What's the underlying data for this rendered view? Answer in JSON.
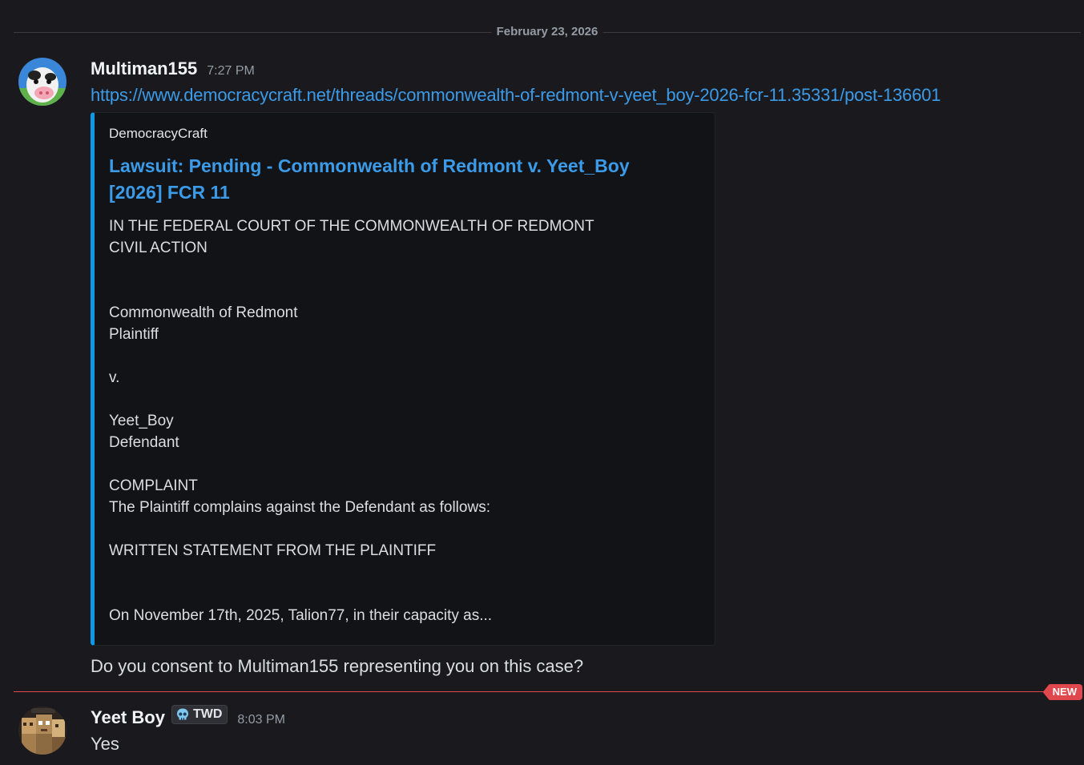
{
  "date_divider": "February 23, 2026",
  "messages": [
    {
      "username": "Multiman155",
      "timestamp": "7:27 PM",
      "avatar_icon": "cow-avatar-icon",
      "link": "https://www.democracycraft.net/threads/commonwealth-of-redmont-v-yeet_boy-2026-fcr-11.35331/post-136601",
      "embed": {
        "provider": "DemocracyCraft",
        "title": "Lawsuit: Pending - Commonwealth of Redmont v. Yeet_Boy [2026] FCR 11",
        "accent_color": "#0b9be6",
        "description_lines": [
          "IN THE FEDERAL COURT OF THE COMMONWEALTH OF REDMONT",
          "CIVIL ACTION",
          "",
          "",
          "Commonwealth of Redmont",
          "Plaintiff",
          "",
          "v.",
          "",
          "Yeet_Boy",
          "Defendant",
          "",
          "COMPLAINT",
          "The Plaintiff complains against the Defendant as follows:",
          "",
          "WRITTEN STATEMENT FROM THE PLAINTIFF",
          "",
          "",
          "On November 17th, 2025, Talion77, in their capacity as..."
        ]
      },
      "text": "Do you consent to Multiman155 representing you on this case?"
    },
    {
      "username": "Yeet Boy",
      "tag": "TWD",
      "tag_icon": "skull-icon",
      "timestamp": "8:03 PM",
      "avatar_icon": "minecraft-avatar-icon",
      "text": "Yes"
    }
  ],
  "new_badge": "NEW",
  "colors": {
    "background": "#1a1a1e",
    "link": "#3b9be8",
    "new_divider": "#e1484e"
  }
}
